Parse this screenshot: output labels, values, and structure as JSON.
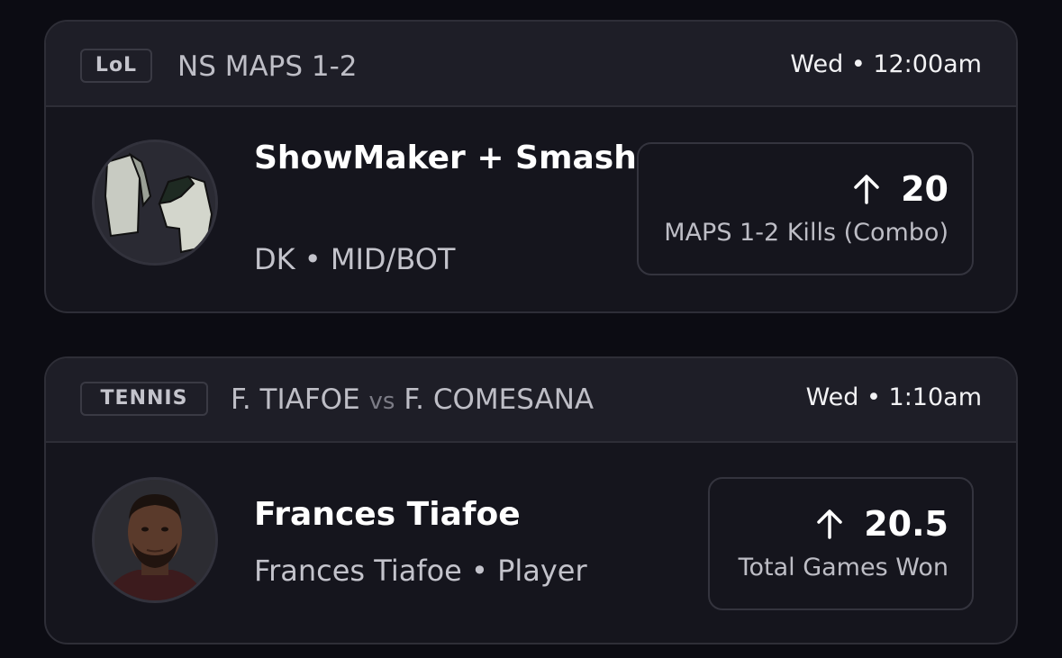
{
  "picks": [
    {
      "league": "LoL",
      "matchup": "NS MAPS 1-2",
      "time": "Wed • 12:00am",
      "player_name": "ShowMaker + Smash",
      "player_info": "DK • MID/BOT",
      "avatar_icon": "jersey-icon",
      "direction": "up-arrow-icon",
      "line": "20",
      "stat": "MAPS 1-2 Kills (Combo)"
    },
    {
      "league": "TENNIS",
      "matchup_home": "F. TIAFOE",
      "matchup_vs": "vs",
      "matchup_away": "F. COMESANA",
      "time": "Wed • 1:10am",
      "player_name": "Frances Tiafoe",
      "player_info": "Frances Tiafoe • Player",
      "avatar_icon": "player-photo",
      "direction": "up-arrow-icon",
      "line": "20.5",
      "stat": "Total Games Won"
    }
  ]
}
